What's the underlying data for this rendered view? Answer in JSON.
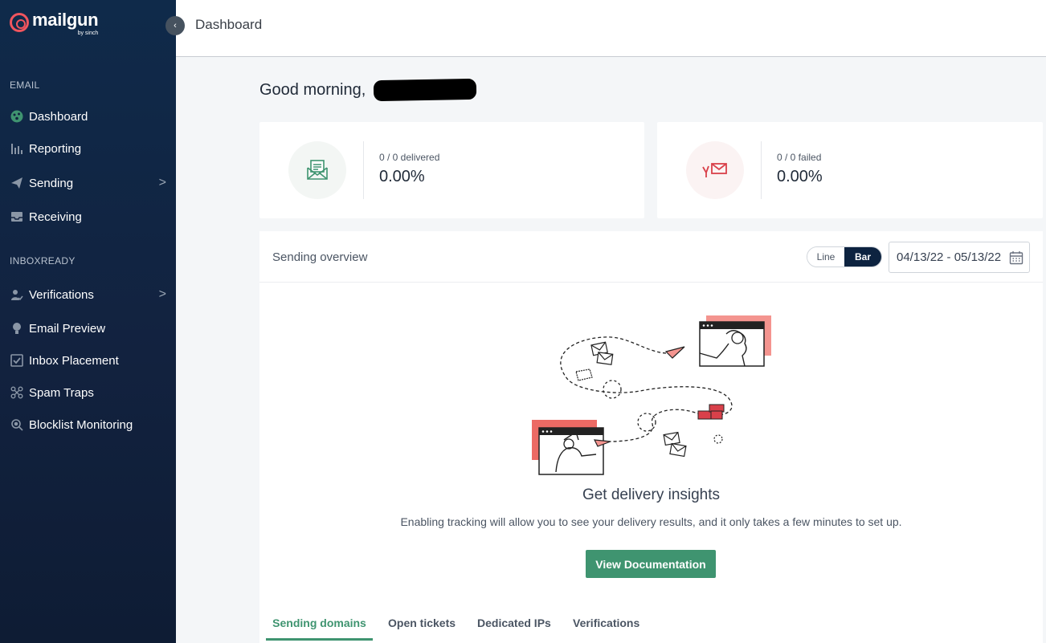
{
  "brand": {
    "name": "mailgun",
    "sub": "by sinch",
    "accent": "#f0555e"
  },
  "sidebar": {
    "sections": [
      {
        "label": "EMAIL"
      },
      {
        "label": "INBOXREADY"
      }
    ],
    "items": [
      {
        "label": "Dashboard",
        "icon": "dashboard-icon"
      },
      {
        "label": "Reporting",
        "icon": "bar-chart-icon"
      },
      {
        "label": "Sending",
        "icon": "paper-plane-icon",
        "chevron": ">"
      },
      {
        "label": "Receiving",
        "icon": "inbox-icon"
      },
      {
        "label": "Verifications",
        "icon": "user-check-icon",
        "chevron": ">"
      },
      {
        "label": "Email Preview",
        "icon": "lightbulb-icon"
      },
      {
        "label": "Inbox Placement",
        "icon": "checkbox-icon"
      },
      {
        "label": "Spam Traps",
        "icon": "network-icon"
      },
      {
        "label": "Blocklist Monitoring",
        "icon": "shield-search-icon"
      }
    ],
    "collapse": "‹"
  },
  "header": {
    "title": "Dashboard"
  },
  "greeting": "Good morning,",
  "stats": [
    {
      "label": "0 / 0 delivered",
      "value": "0.00%",
      "icon": "envelope-open-icon"
    },
    {
      "label": "0 / 0 failed",
      "value": "0.00%",
      "icon": "envelope-failed-icon"
    }
  ],
  "overview": {
    "title": "Sending overview",
    "toggle": {
      "line": "Line",
      "bar": "Bar",
      "selected": "Bar"
    },
    "date_range": "04/13/22 - 05/13/22",
    "empty_title": "Get delivery insights",
    "empty_text": "Enabling tracking will allow you to see your delivery results, and it only takes a few minutes to set up.",
    "cta": "View Documentation"
  },
  "tabs": [
    {
      "label": "Sending domains",
      "active": true
    },
    {
      "label": "Open tickets",
      "active": false
    },
    {
      "label": "Dedicated IPs",
      "active": false
    },
    {
      "label": "Verifications",
      "active": false
    }
  ],
  "colors": {
    "primary_green": "#3f9470",
    "navy": "#0d2340",
    "sidebar_bg": "#12223f"
  }
}
